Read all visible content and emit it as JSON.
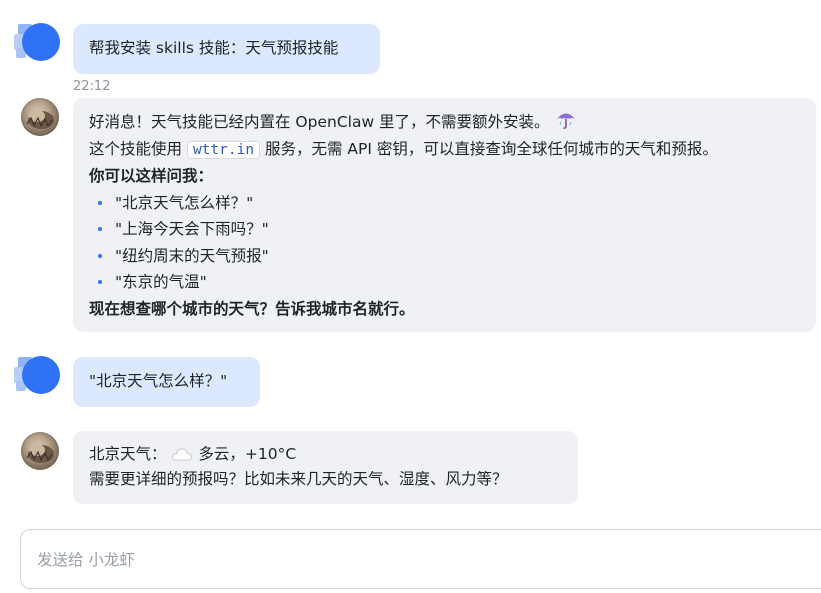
{
  "messages": {
    "user1": {
      "text": "帮我安装 skills 技能：天气预报技能",
      "time": "22:12"
    },
    "bot1": {
      "line1": "好消息！天气技能已经内置在 OpenClaw 里了，不需要额外安装。",
      "line1_icon": "umbrella-icon",
      "line2_prefix": "这个技能使用 ",
      "line2_code": "wttr.in",
      "line2_suffix": " 服务，无需 API 密钥，可以直接查询全球任何城市的天气和预报。",
      "heading": "你可以这样问我：",
      "examples": [
        "\"北京天气怎么样？\"",
        "\"上海今天会下雨吗？\"",
        "\"纽约周末的天气预报\"",
        "\"东京的气温\""
      ],
      "closing": "现在想查哪个城市的天气？告诉我城市名就行。"
    },
    "user2": {
      "text": "\"北京天气怎么样？\""
    },
    "bot2": {
      "weather_prefix": "北京天气：",
      "weather_icon": "cloud-icon",
      "weather_desc": "多云，+10°C",
      "followup": "需要更详细的预报吗？比如未来几天的天气、湿度、风力等？"
    }
  },
  "composer": {
    "placeholder": "发送给 小龙虾"
  },
  "colors": {
    "user_bubble": "#dce8fd",
    "bot_bubble": "#eff1f4",
    "user_avatar": "#2f72f5",
    "bullet": "#3370ff",
    "code_text": "#2e5bb8"
  }
}
